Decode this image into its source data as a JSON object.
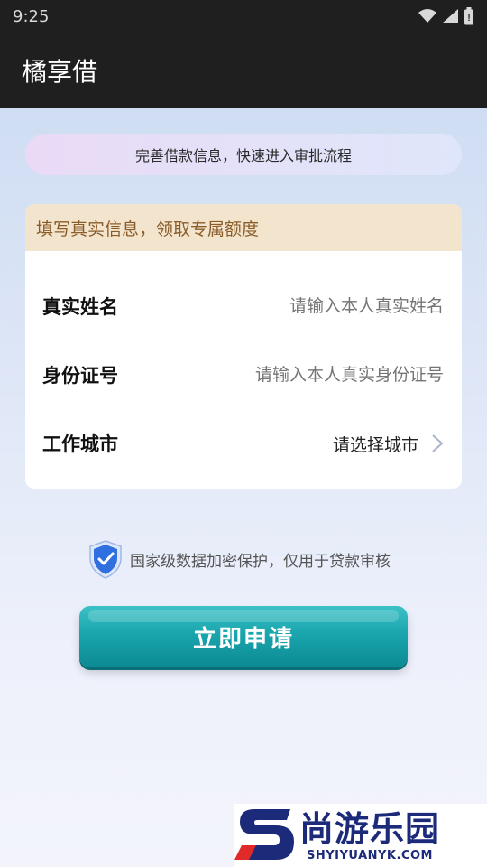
{
  "status_bar": {
    "time": "9:25"
  },
  "app_bar": {
    "title": "橘享借"
  },
  "banner": {
    "text": "完善借款信息，快速进入审批流程"
  },
  "form": {
    "header": "填写真实信息，领取专属额度",
    "name_row": {
      "label": "真实姓名",
      "placeholder": "请输入本人真实姓名"
    },
    "id_row": {
      "label": "身份证号",
      "placeholder": "请输入本人真实身份证号"
    },
    "city_row": {
      "label": "工作城市",
      "value": "请选择城市"
    }
  },
  "notice": {
    "text": "国家级数据加密保护，仅用于贷款审核",
    "icon": "shield-check-icon"
  },
  "apply_button": {
    "label": "立即申请"
  },
  "watermark": {
    "title": "尚游乐园",
    "url": "SHYIYUANYK.COM"
  },
  "colors": {
    "header_bg": "#1f1f1f",
    "accent_teal": "#1aa5ad",
    "card_header_bg": "#f3e5cd",
    "card_header_text": "#8a5c2a",
    "shield_blue": "#2f6fe0"
  }
}
